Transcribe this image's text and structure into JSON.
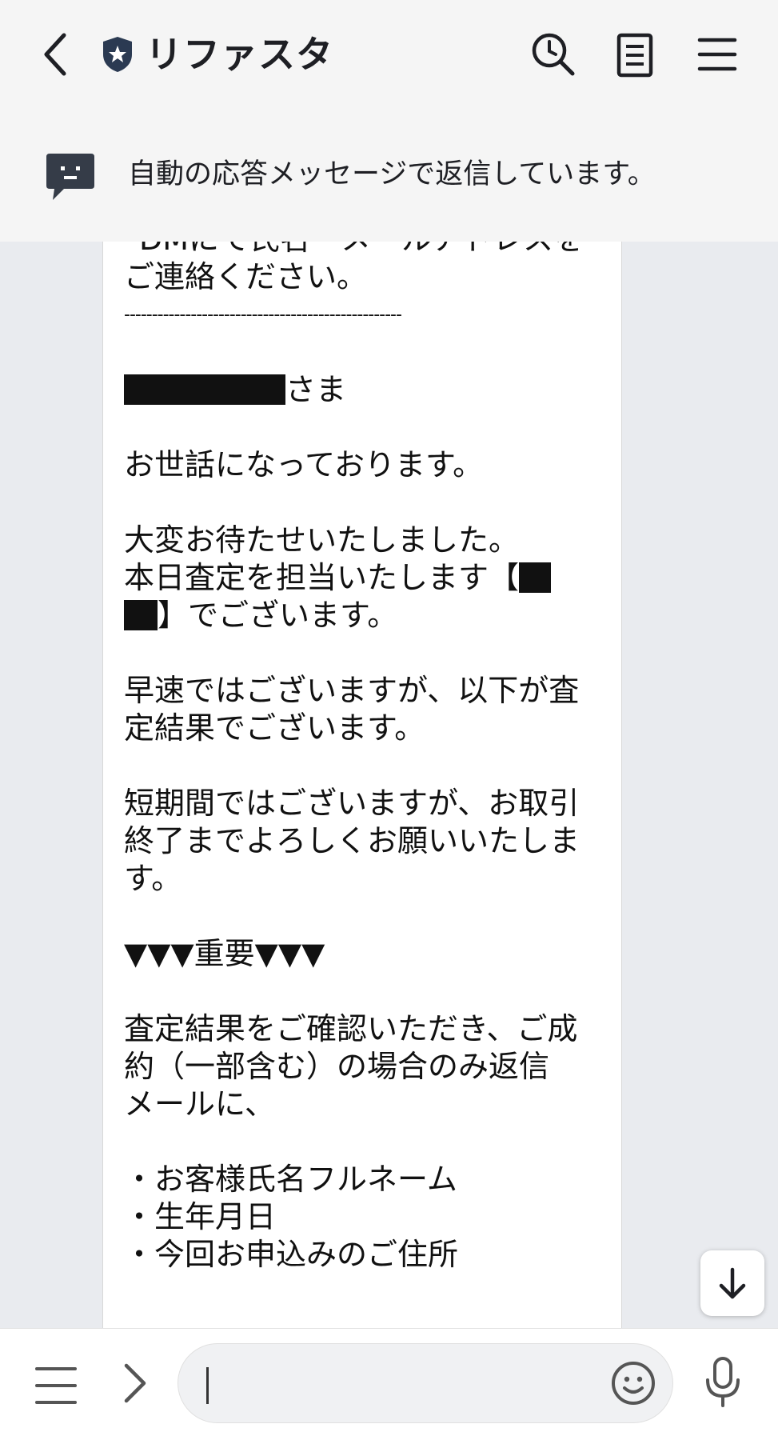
{
  "header": {
    "title": "リファスタ",
    "notice": "自動の応答メッセージで返信しています。"
  },
  "message": {
    "lines": [
      "*DMにて氏名・メールアドレスを",
      "ご連絡ください。",
      "--------------------------------------------------",
      "",
      "さま",
      "",
      "お世話になっております。",
      "",
      "大変お待たせいたしました。",
      "本日査定を担当いたします【",
      "】でございます。",
      "",
      "早速ではございますが、以下が査",
      "定結果でございます。",
      "",
      "短期間ではございますが、お取引",
      "終了までよろしくお願いいたしま",
      "す。",
      "",
      "▼▼▼重要▼▼▼",
      "",
      "査定結果をご確認いただき、ご成",
      "約（一部含む）の場合のみ返信",
      "メールに、",
      "",
      "・お客様氏名フルネーム",
      "・生年月日",
      "・今回お申込みのご住所"
    ]
  },
  "colors": {
    "header_bg": "#f5f5f5",
    "chat_bg": "#e9ebef",
    "bubble_bg": "#ffffff",
    "icon_dark": "#2b2f38"
  }
}
